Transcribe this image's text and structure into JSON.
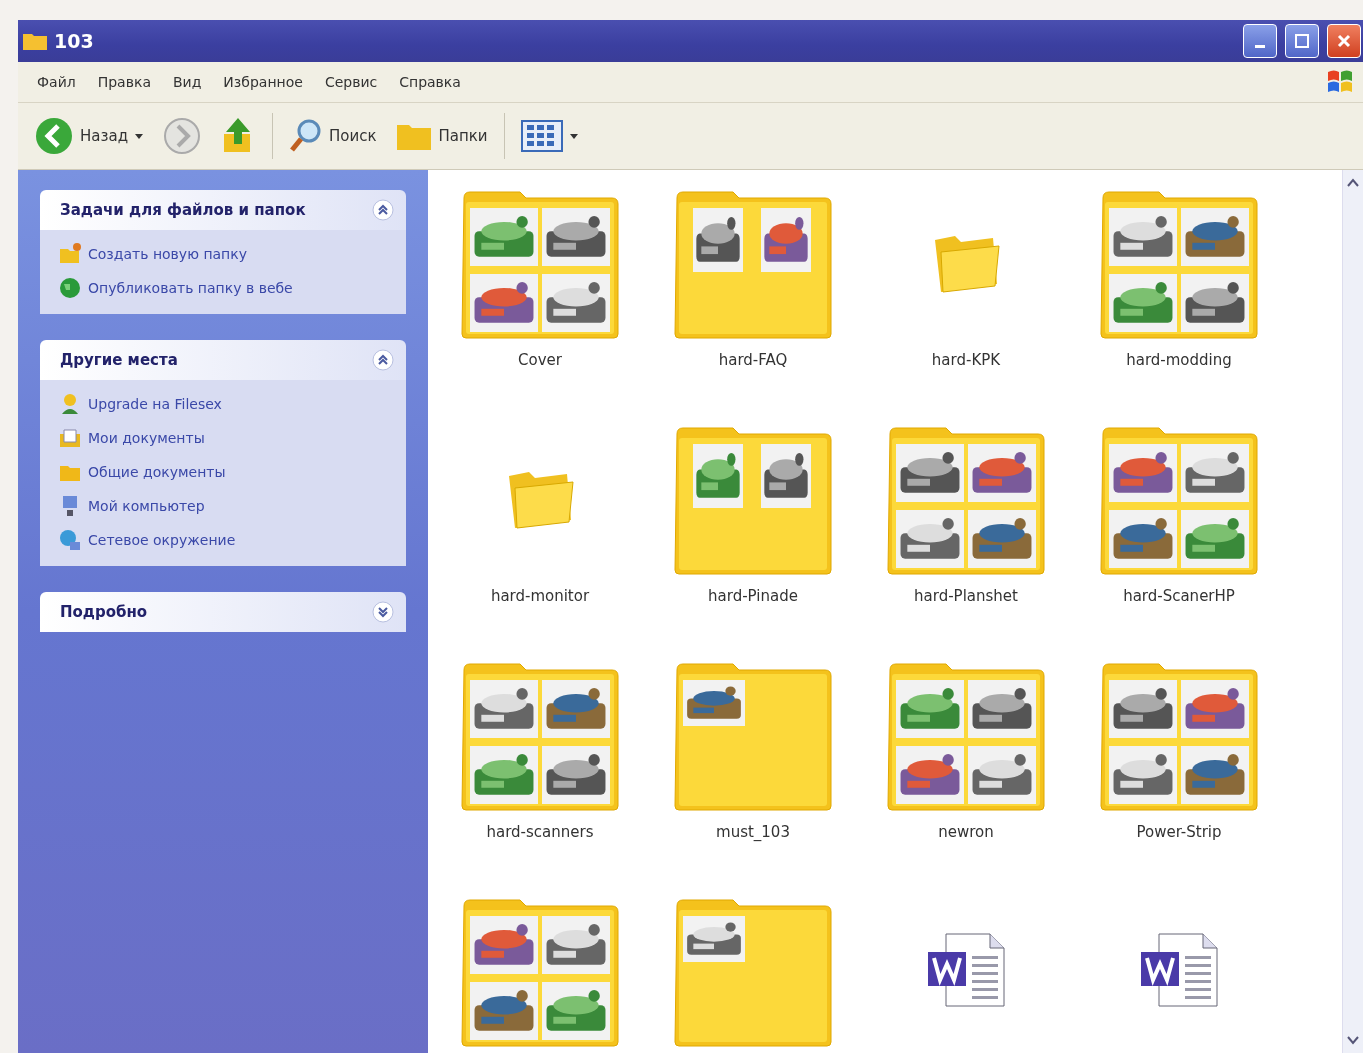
{
  "window": {
    "title": "103"
  },
  "menu": [
    "Файл",
    "Правка",
    "Вид",
    "Избранное",
    "Сервис",
    "Справка"
  ],
  "toolbar": {
    "back": "Назад",
    "search": "Поиск",
    "folders": "Папки"
  },
  "sidebar": [
    {
      "title": "Задачи для файлов и папок",
      "expanded": true,
      "links": [
        {
          "kind": "new-folder",
          "label": "Создать новую папку"
        },
        {
          "kind": "publish",
          "label": "Опубликовать папку в вебе"
        }
      ]
    },
    {
      "title": "Другие места",
      "expanded": true,
      "links": [
        {
          "kind": "user",
          "label": "Upgrade на Filesex"
        },
        {
          "kind": "my-docs",
          "label": "Мои документы"
        },
        {
          "kind": "shared-docs",
          "label": "Общие документы"
        },
        {
          "kind": "computer",
          "label": "Мой компьютер"
        },
        {
          "kind": "network",
          "label": "Сетевое окружение"
        }
      ]
    },
    {
      "title": "Подробно",
      "expanded": false
    }
  ],
  "items": [
    {
      "kind": "preview-folder",
      "name": "Cover"
    },
    {
      "kind": "preview-folder",
      "name": "hard-FAQ"
    },
    {
      "kind": "folder",
      "name": "hard-KPK"
    },
    {
      "kind": "preview-folder",
      "name": "hard-modding"
    },
    {
      "kind": "folder",
      "name": "hard-monitor"
    },
    {
      "kind": "preview-folder",
      "name": "hard-Pinade"
    },
    {
      "kind": "preview-folder",
      "name": "hard-Planshet"
    },
    {
      "kind": "preview-folder",
      "name": "hard-ScanerHP"
    },
    {
      "kind": "preview-folder",
      "name": "hard-scanners"
    },
    {
      "kind": "preview-folder",
      "name": "must_103"
    },
    {
      "kind": "preview-folder",
      "name": "newron"
    },
    {
      "kind": "preview-folder",
      "name": "Power-Strip"
    },
    {
      "kind": "preview-folder"
    },
    {
      "kind": "preview-folder"
    },
    {
      "kind": "word-doc"
    },
    {
      "kind": "word-doc"
    }
  ]
}
